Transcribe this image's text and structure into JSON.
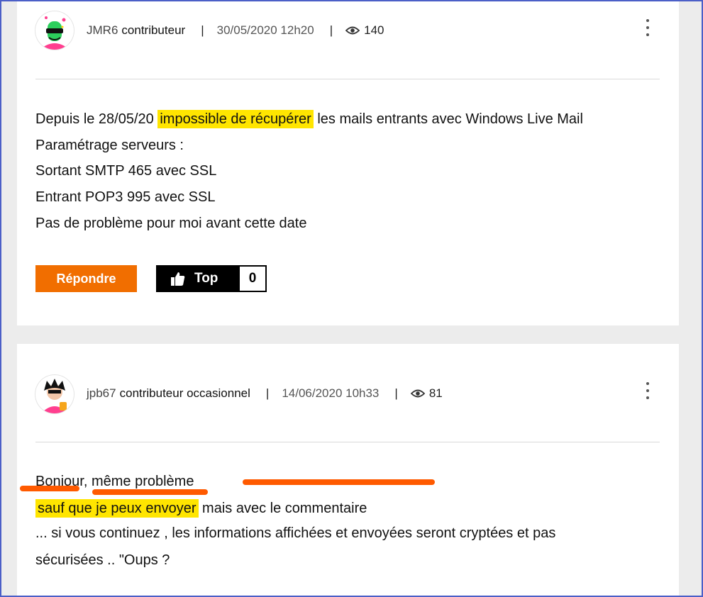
{
  "posts": [
    {
      "username": "JMR6",
      "role": "contributeur",
      "separator": "|",
      "date": "30/05/2020 12h20",
      "views": "140",
      "lines": [
        {
          "before": "Depuis le 28/05/20 ",
          "highlight": "impossible de récupérer",
          "after": " les mails entrants avec Windows Live Mail"
        },
        {
          "text": "Paramétrage serveurs :"
        },
        {
          "text": "Sortant SMTP 465 avec SSL"
        },
        {
          "text": "Entrant POP3 995 avec SSL"
        },
        {
          "text": "Pas de problème pour moi avant cette date"
        }
      ],
      "reply_label": "Répondre",
      "top_label": "Top",
      "top_count": "0"
    },
    {
      "username": "jpb67",
      "role": "contributeur occasionnel",
      "separator": "|",
      "date": "14/06/2020 10h33",
      "views": "81",
      "lines": [
        {
          "text": "Bonjour, même problème"
        },
        {
          "highlight": "sauf que je peux envoyer",
          "after": " mais avec le commentaire"
        },
        {
          "text": "... si vous continuez , les informations affichées et envoyées seront cryptées et pas"
        },
        {
          "text": "sécurisées .. \"Oups ?"
        }
      ]
    }
  ],
  "colors": {
    "accent_orange": "#f16e00",
    "highlight_yellow": "#ffe500",
    "annotation_orange": "#ff5a00",
    "frame_blue": "#4b5fc7"
  },
  "icons": {
    "views": "eye-icon",
    "menu": "kebab-menu-icon",
    "top": "thumbs-up-icon"
  }
}
